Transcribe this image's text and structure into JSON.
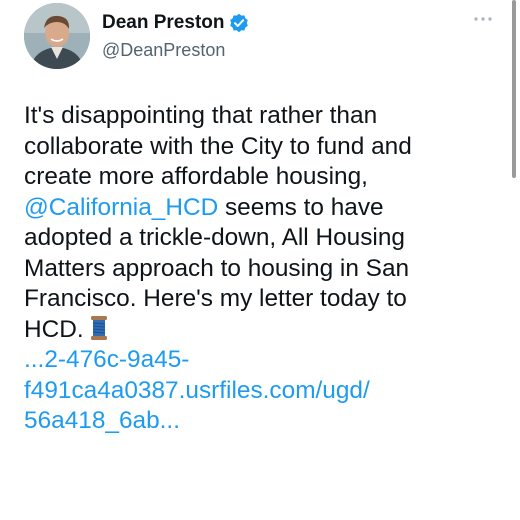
{
  "user": {
    "display_name": "Dean Preston",
    "handle": "@DeanPreston",
    "verified": true,
    "avatar_icon": "profile-photo"
  },
  "tweet": {
    "line1": "It's disappointing that rather than",
    "line2": "collaborate with the City to fund and",
    "line3": "create more affordable housing,",
    "mention": "@California_HCD",
    "line4_rest": " seems to have",
    "line5": "adopted a trickle-down, All Housing",
    "line6": "Matters approach to housing in San",
    "line7": "Francisco. Here's my letter today to",
    "line8": "HCD.",
    "emoji_icon": "thread-spool-icon",
    "link_line1": "...2-476c-9a45-",
    "link_line2": "f491ca4a0387.usrfiles.com/ugd/",
    "link_line3": "56a418_6ab..."
  },
  "colors": {
    "text": "#0f1419",
    "secondary": "#536471",
    "accent": "#1d9bf0"
  }
}
